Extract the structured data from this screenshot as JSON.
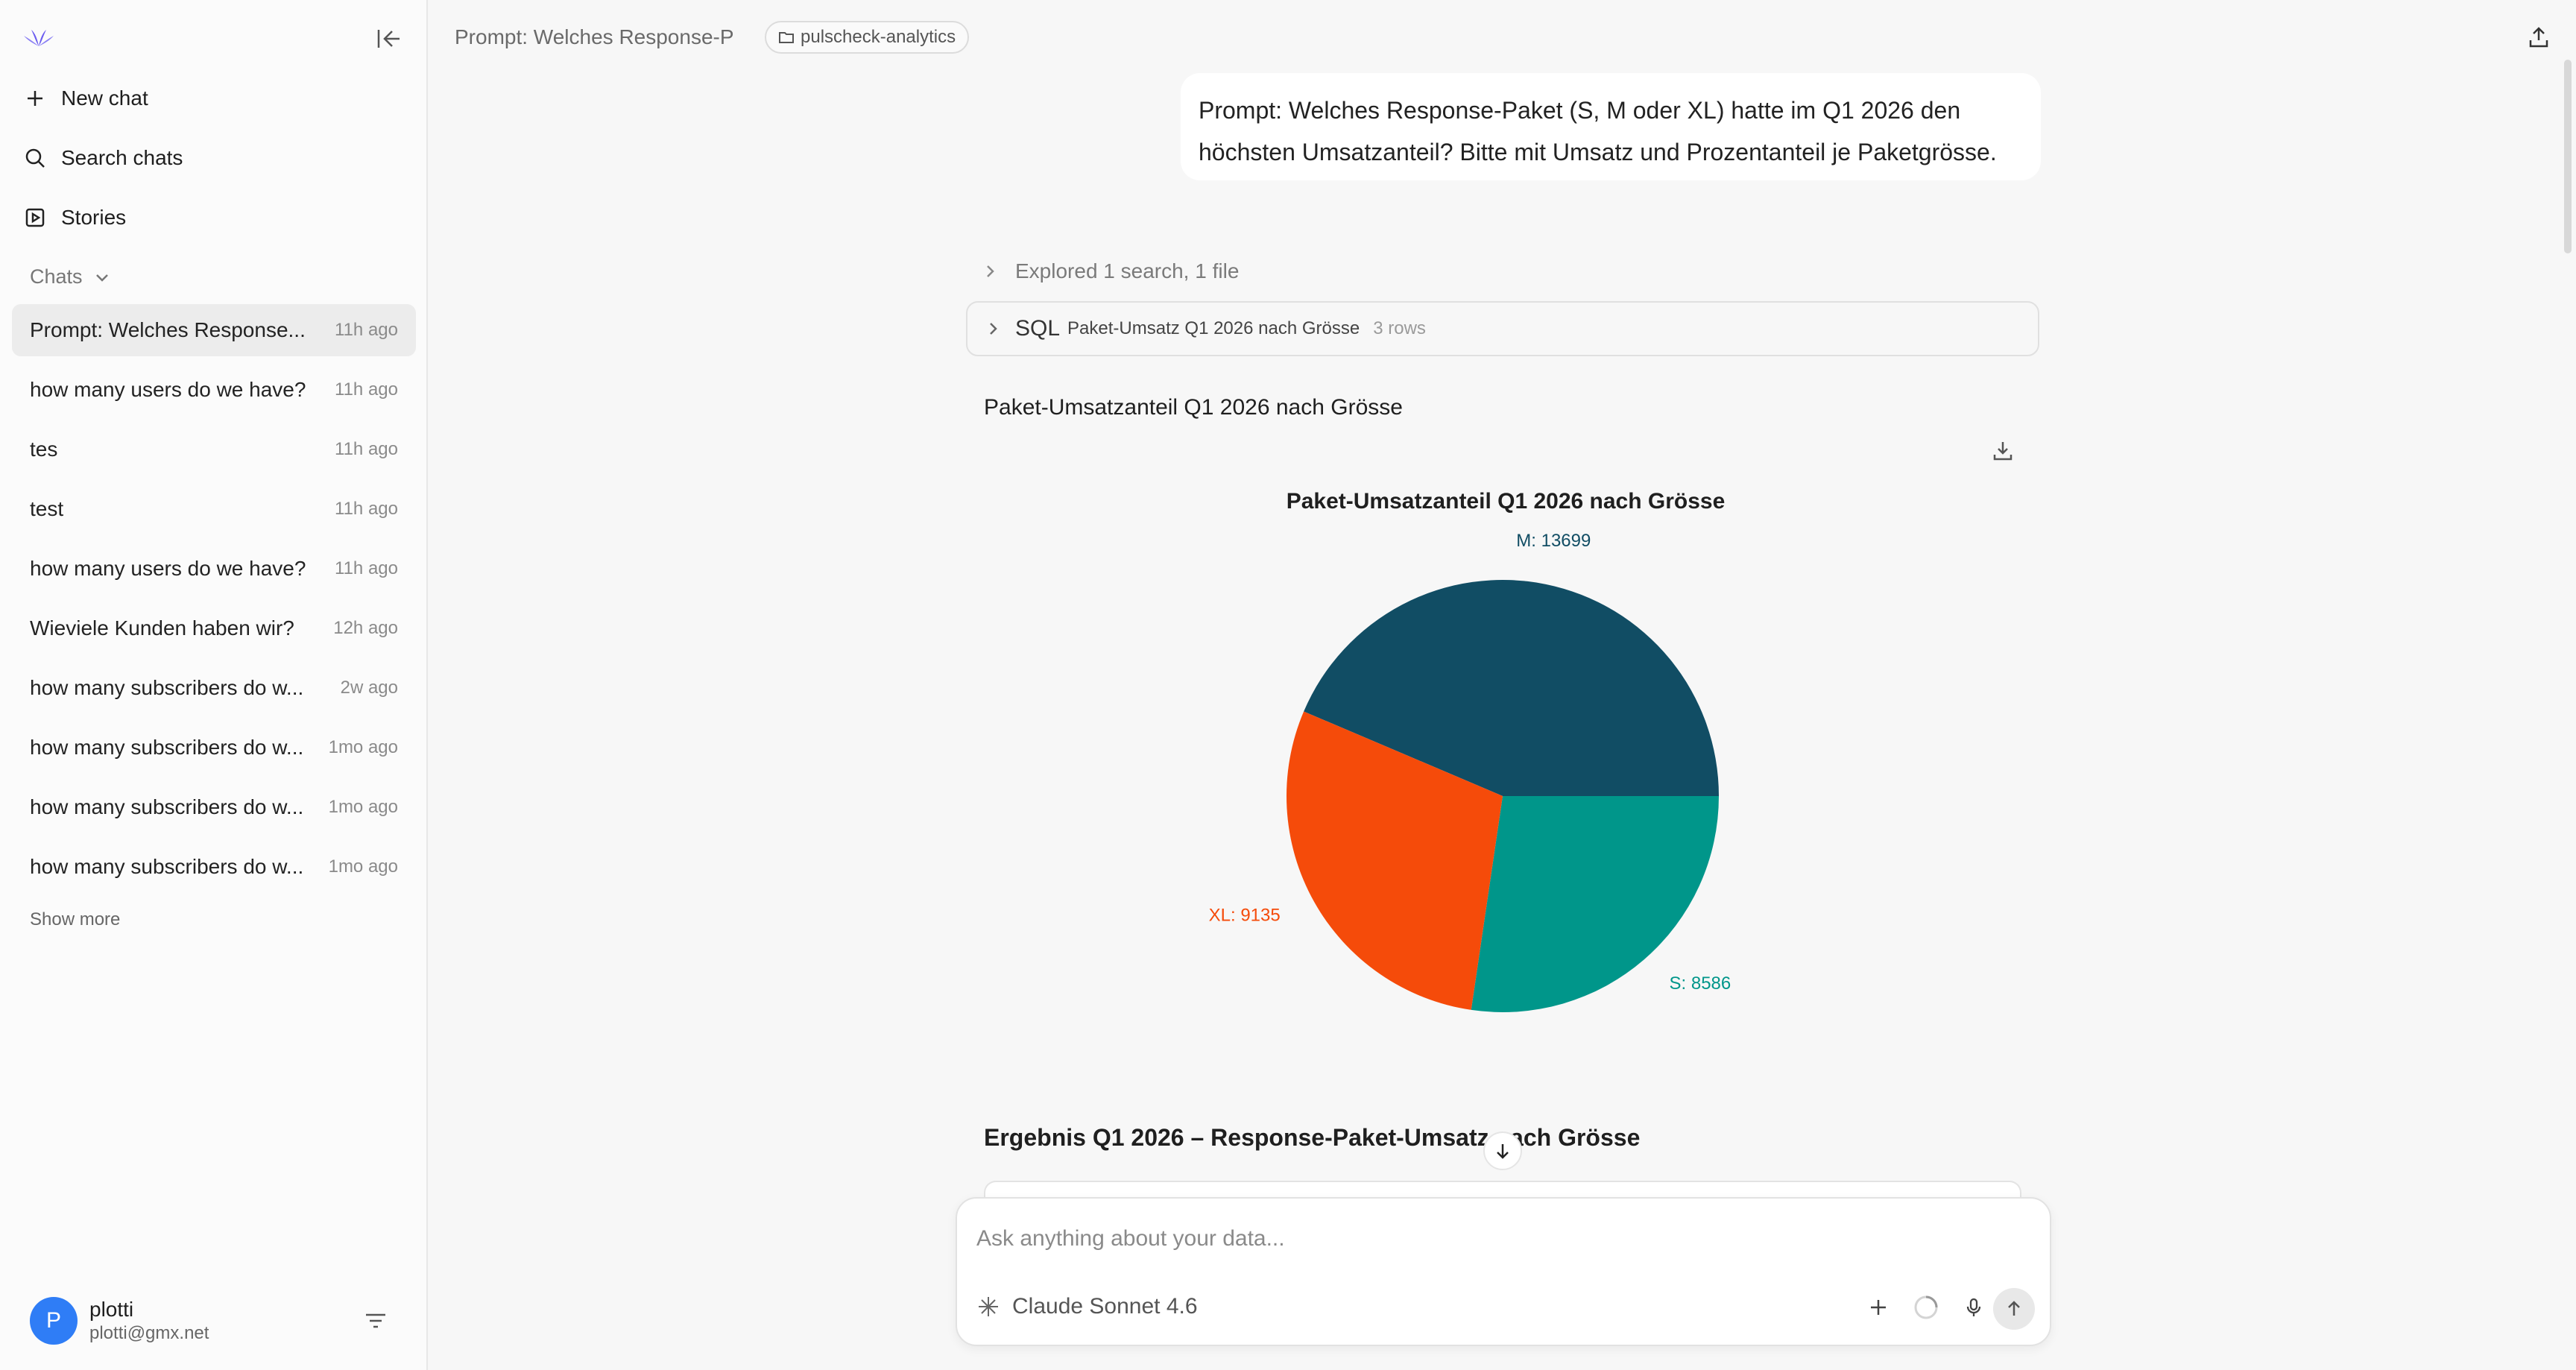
{
  "sidebar": {
    "new_chat": "New chat",
    "search_chats": "Search chats",
    "stories": "Stories",
    "chats_header": "Chats",
    "chats": [
      {
        "title": "Prompt: Welches Response...",
        "time": "11h ago",
        "active": true
      },
      {
        "title": "how many users do we have?",
        "time": "11h ago"
      },
      {
        "title": "tes",
        "time": "11h ago"
      },
      {
        "title": "test",
        "time": "11h ago"
      },
      {
        "title": "how many users do we have?",
        "time": "11h ago"
      },
      {
        "title": "Wieviele Kunden haben wir?",
        "time": "12h ago"
      },
      {
        "title": "how many subscribers do w...",
        "time": "2w ago"
      },
      {
        "title": "how many subscribers do w...",
        "time": "1mo ago"
      },
      {
        "title": "how many subscribers do w...",
        "time": "1mo ago"
      },
      {
        "title": "how many subscribers do w...",
        "time": "1mo ago"
      }
    ],
    "show_more": "Show more",
    "user": {
      "initial": "P",
      "name": "plotti",
      "email": "plotti@gmx.net"
    }
  },
  "topbar": {
    "title": "Prompt: Welches Response-P",
    "project": "pulscheck-analytics"
  },
  "conversation": {
    "user_message": "Prompt: Welches Response-Paket (S, M oder XL) hatte im Q1 2026 den höchsten Umsatzanteil? Bitte mit Umsatz und Prozentanteil je Paketgrösse.",
    "explored": "Explored 1 search, 1 file",
    "sql": {
      "label": "SQL",
      "title": "Paket-Umsatz Q1 2026 nach Grösse",
      "rows": "3 rows"
    },
    "chart_section_title": "Paket-Umsatzanteil Q1 2026 nach Grösse",
    "result_heading": "Ergebnis Q1 2026 – Response-Paket-Umsatz nach Grösse"
  },
  "chart_data": {
    "type": "pie",
    "title": "Paket-Umsatzanteil Q1 2026 nach Grösse",
    "slices": [
      {
        "label": "M",
        "value": 13699,
        "display": "M: 13699",
        "color": "#114d64"
      },
      {
        "label": "S",
        "value": 8586,
        "display": "S: 8586",
        "color": "#00968a"
      },
      {
        "label": "XL",
        "value": 9135,
        "display": "XL: 9135",
        "color": "#f54b0a"
      }
    ]
  },
  "composer": {
    "placeholder": "Ask anything about your data...",
    "model": "Claude Sonnet 4.6"
  }
}
